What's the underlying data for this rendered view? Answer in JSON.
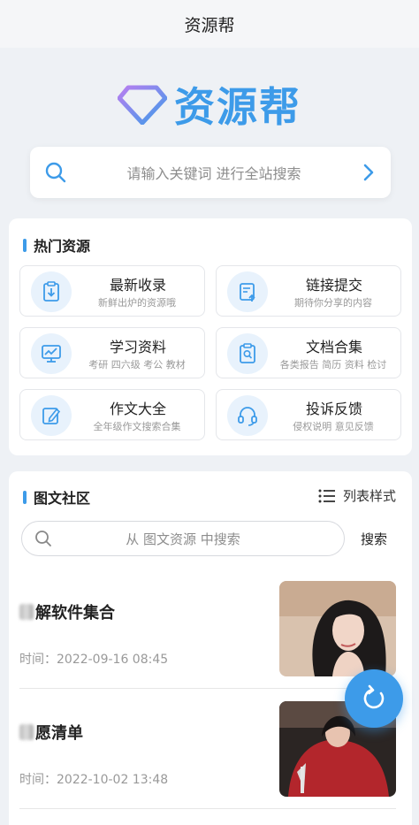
{
  "header": {
    "title": "资源帮"
  },
  "logo": {
    "text": "资源帮"
  },
  "search": {
    "placeholder": "请输入关键词 进行全站搜索"
  },
  "hot": {
    "title": "热门资源",
    "items": [
      {
        "title": "最新收录",
        "subtitle": "新鲜出炉的资源哦",
        "icon": "download-clipboard-icon"
      },
      {
        "title": "链接提交",
        "subtitle": "期待你分享的内容",
        "icon": "upload-document-icon"
      },
      {
        "title": "学习资料",
        "subtitle": "考研 四六级 考公 教材",
        "icon": "chart-board-icon"
      },
      {
        "title": "文档合集",
        "subtitle": "各类报告 简历 资料 检讨",
        "icon": "search-document-icon"
      },
      {
        "title": "作文大全",
        "subtitle": "全年级作文搜索合集",
        "icon": "edit-icon"
      },
      {
        "title": "投诉反馈",
        "subtitle": "侵权说明 意见反馈",
        "icon": "headset-icon"
      }
    ]
  },
  "community": {
    "title": "图文社区",
    "list_style_label": "列表样式",
    "search_placeholder": "从 图文资源 中搜索",
    "search_button": "搜索",
    "posts": [
      {
        "title": "解软件集合",
        "time": "时间：2022-09-16 08:45"
      },
      {
        "title": "愿清单",
        "time": "时间：2022-10-02 13:48"
      }
    ]
  },
  "colors": {
    "accent": "#3d9be9",
    "background": "#eef1f5"
  }
}
